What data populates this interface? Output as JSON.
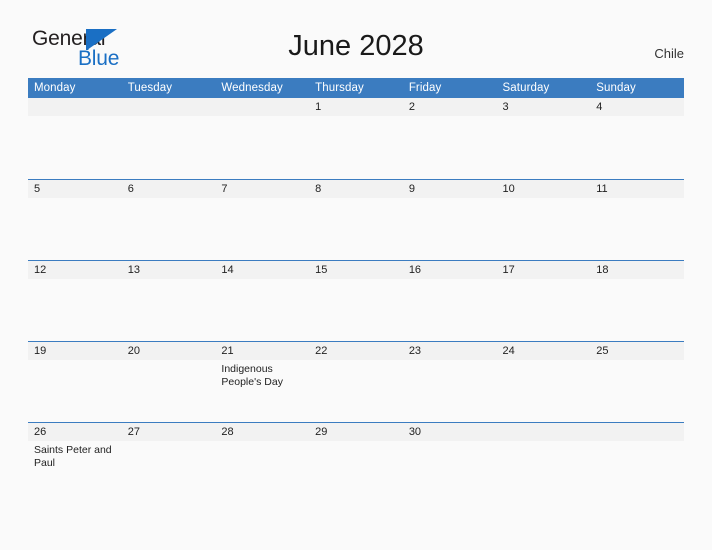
{
  "brand": {
    "name_part1": "General",
    "name_part2": "Blue",
    "mark_icon": "triangle-flag-icon",
    "color_primary": "#1a6fc4",
    "color_text": "#231f20"
  },
  "header": {
    "title": "June 2028",
    "region": "Chile",
    "header_bg_color": "#3b7cc0",
    "band_bg_color": "#f2f2f2"
  },
  "calendar": {
    "weekday_headers": [
      "Monday",
      "Tuesday",
      "Wednesday",
      "Thursday",
      "Friday",
      "Saturday",
      "Sunday"
    ],
    "weeks": [
      [
        {
          "day": "",
          "events": []
        },
        {
          "day": "",
          "events": []
        },
        {
          "day": "",
          "events": []
        },
        {
          "day": "1",
          "events": []
        },
        {
          "day": "2",
          "events": []
        },
        {
          "day": "3",
          "events": []
        },
        {
          "day": "4",
          "events": []
        }
      ],
      [
        {
          "day": "5",
          "events": []
        },
        {
          "day": "6",
          "events": []
        },
        {
          "day": "7",
          "events": []
        },
        {
          "day": "8",
          "events": []
        },
        {
          "day": "9",
          "events": []
        },
        {
          "day": "10",
          "events": []
        },
        {
          "day": "11",
          "events": []
        }
      ],
      [
        {
          "day": "12",
          "events": []
        },
        {
          "day": "13",
          "events": []
        },
        {
          "day": "14",
          "events": []
        },
        {
          "day": "15",
          "events": []
        },
        {
          "day": "16",
          "events": []
        },
        {
          "day": "17",
          "events": []
        },
        {
          "day": "18",
          "events": []
        }
      ],
      [
        {
          "day": "19",
          "events": []
        },
        {
          "day": "20",
          "events": []
        },
        {
          "day": "21",
          "events": [
            "Indigenous People's Day"
          ]
        },
        {
          "day": "22",
          "events": []
        },
        {
          "day": "23",
          "events": []
        },
        {
          "day": "24",
          "events": []
        },
        {
          "day": "25",
          "events": []
        }
      ],
      [
        {
          "day": "26",
          "events": [
            "Saints Peter and Paul"
          ]
        },
        {
          "day": "27",
          "events": []
        },
        {
          "day": "28",
          "events": []
        },
        {
          "day": "29",
          "events": []
        },
        {
          "day": "30",
          "events": []
        },
        {
          "day": "",
          "events": []
        },
        {
          "day": "",
          "events": []
        }
      ]
    ]
  }
}
